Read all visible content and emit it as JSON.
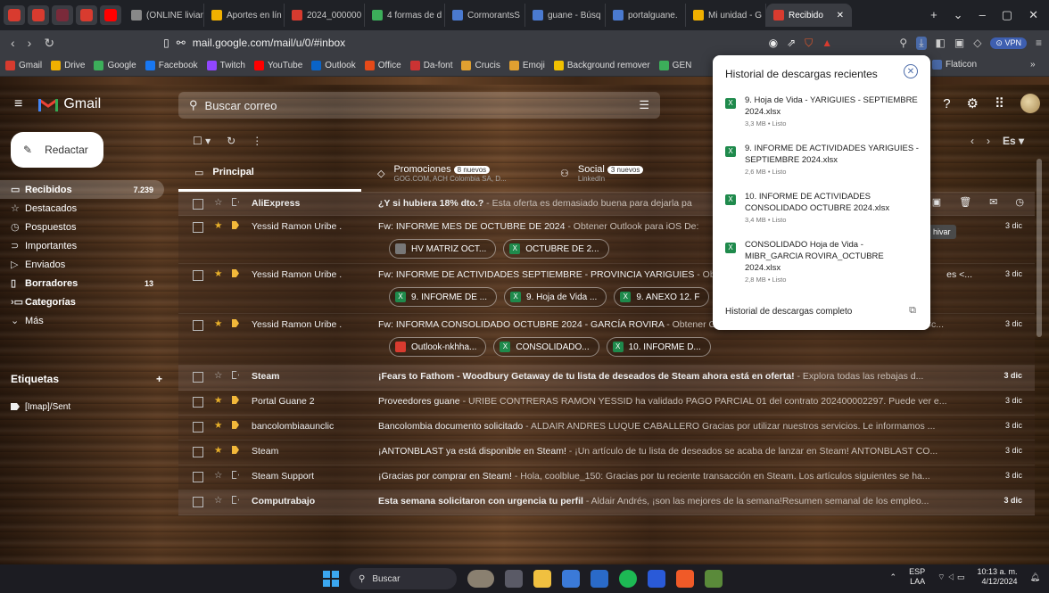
{
  "browser": {
    "tabs": [
      {
        "label": "(ONLINE livian",
        "color": "#888888"
      },
      {
        "label": "Aportes en lín",
        "color": "#f0b000"
      },
      {
        "label": "2024_000000",
        "color": "#d83b2f"
      },
      {
        "label": "4 formas de d",
        "color": "#3cae5a"
      },
      {
        "label": "CormorantsS",
        "color": "#4a7ad0"
      },
      {
        "label": "guane - Búsq",
        "color": "#4a7ad0"
      },
      {
        "label": "portalguane.",
        "color": "#4a7ad0"
      },
      {
        "label": "Mi unidad - G",
        "color": "#f0b000"
      },
      {
        "label": "Recibido",
        "color": "#d83b2f"
      }
    ],
    "url": "mail.google.com/mail/u/0/#inbox",
    "vpn_label": "VPN",
    "bookmarks": [
      {
        "label": "Gmail",
        "color": "#d83b2f"
      },
      {
        "label": "Drive",
        "color": "#f0b000"
      },
      {
        "label": "Google",
        "color": "#3cae5a"
      },
      {
        "label": "Facebook",
        "color": "#1877f2"
      },
      {
        "label": "Twitch",
        "color": "#9146ff"
      },
      {
        "label": "YouTube",
        "color": "#ff0000"
      },
      {
        "label": "Outlook",
        "color": "#0a64c8"
      },
      {
        "label": "Office",
        "color": "#e64a19"
      },
      {
        "label": "Da-font",
        "color": "#cc3333"
      },
      {
        "label": "Crucis",
        "color": "#e0a030"
      },
      {
        "label": "Emoji",
        "color": "#e0a030"
      },
      {
        "label": "Background remover",
        "color": "#f0c000"
      },
      {
        "label": "GEN",
        "color": "#3cae5a"
      }
    ],
    "bookmark_right": "Flaticon"
  },
  "gmail": {
    "app_name": "Gmail",
    "search_placeholder": "Buscar correo",
    "compose": "Redactar",
    "lang": "Es",
    "nav": [
      {
        "label": "Recibidos",
        "count": "7.239",
        "icon": "inbox-icon",
        "selected": true
      },
      {
        "label": "Destacados",
        "count": "",
        "icon": "star-icon"
      },
      {
        "label": "Pospuestos",
        "count": "",
        "icon": "clock-icon"
      },
      {
        "label": "Importantes",
        "count": "",
        "icon": "important-icon"
      },
      {
        "label": "Enviados",
        "count": "",
        "icon": "send-icon"
      },
      {
        "label": "Borradores",
        "count": "13",
        "icon": "draft-icon",
        "bold": true
      },
      {
        "label": "Categorías",
        "count": "",
        "icon": "label-icon",
        "bold": true
      },
      {
        "label": "Más",
        "count": "",
        "icon": "chevron-down-icon"
      }
    ],
    "labels_title": "Etiquetas",
    "labels_add": "+",
    "labels": [
      "[Imap]/Sent"
    ],
    "category_tabs": {
      "principal": "Principal",
      "promociones": "Promociones",
      "promociones_badge": "8 nuevos",
      "promociones_sub": "GOG.COM, ACH Colombia SA, D...",
      "social": "Social",
      "social_badge": "3 nuevos",
      "social_sub": "LinkedIn"
    },
    "archive_tooltip": "hivar",
    "emails": [
      {
        "sender": "AliExpress",
        "subject": "¿Y si hubiera 18% dto.?",
        "snippet": " - Esta oferta es demasiado buena para dejarla pa",
        "date": "",
        "bold": true,
        "starred": false,
        "chips": []
      },
      {
        "sender": "Yessid Ramon Uribe .",
        "subject": "Fw: INFORME MES DE OCTUBRE DE 2024",
        "snippet": " - Obtener Outlook para iOS De:",
        "date": "3 dic",
        "bold": false,
        "starred": true,
        "chips": [
          {
            "label": "HV MATRIZ OCT...",
            "type": "doc"
          },
          {
            "label": "OCTUBRE DE 2...",
            "type": "xl"
          }
        ]
      },
      {
        "sender": "Yessid Ramon Uribe .",
        "subject": "Fw: INFORME DE ACTIVIDADES SEPTIEMBRE - PROVINCIA YARIGUIES",
        "snippet": " - Ob",
        "date": "3 dic",
        "bold": false,
        "starred": true,
        "chips": [
          {
            "label": "9. INFORME DE ...",
            "type": "xl"
          },
          {
            "label": "9. Hoja de Vida ...",
            "type": "xl"
          },
          {
            "label": "9. ANEXO 12. F",
            "type": "xl"
          }
        ],
        "trail": "es <..."
      },
      {
        "sender": "Yessid Ramon Uribe .",
        "subject": "Fw: INFORMA CONSOLIDADO OCTUBRE 2024 - GARCÍA ROVIRA",
        "snippet": " - Obtener Outlook para iOS De: Hugo Armando Argote Acosta <c...",
        "date": "3 dic",
        "bold": false,
        "starred": true,
        "chips": [
          {
            "label": "Outlook-nkhha...",
            "type": "pdfi"
          },
          {
            "label": "CONSOLIDADO...",
            "type": "xl"
          },
          {
            "label": "10. INFORME D...",
            "type": "xl"
          }
        ]
      },
      {
        "sender": "Steam",
        "subject": "¡Fears to Fathom - Woodbury Getaway de tu lista de deseados de Steam ahora está en oferta!",
        "snippet": " - Explora todas las rebajas d...",
        "date": "3 dic",
        "bold": true,
        "starred": false,
        "chips": []
      },
      {
        "sender": "Portal Guane 2",
        "subject": "Proveedores guane",
        "snippet": " - URIBE CONTRERAS RAMON YESSID ha validado PAGO PARCIAL 01 del contrato 202400002297. Puede ver e...",
        "date": "3 dic",
        "bold": false,
        "starred": true,
        "chips": []
      },
      {
        "sender": "bancolombiaaunclic",
        "subject": "Bancolombia documento solicitado",
        "snippet": " - ALDAIR ANDRES LUQUE CABALLERO Gracias por utilizar nuestros servicios. Le informamos ...",
        "date": "3 dic",
        "bold": false,
        "starred": true,
        "chips": []
      },
      {
        "sender": "Steam",
        "subject": "¡ANTONBLAST ya está disponible en Steam!",
        "snippet": " - ¡Un artículo de tu lista de deseados se acaba de lanzar en Steam! ANTONBLAST CO...",
        "date": "3 dic",
        "bold": false,
        "starred": true,
        "chips": []
      },
      {
        "sender": "Steam Support",
        "subject": "¡Gracias por comprar en Steam!",
        "snippet": " - Hola, coolblue_150: Gracias por tu reciente transacción en Steam. Los artículos siguientes se ha...",
        "date": "3 dic",
        "bold": false,
        "starred": false,
        "chips": []
      },
      {
        "sender": "Computrabajo",
        "subject": "Esta semana solicitaron con urgencia tu perfil",
        "snippet": " - Aldair Andrés, ¡son las mejores de la semana!Resumen semanal de los empleo...",
        "date": "3 dic",
        "bold": true,
        "starred": false,
        "chips": []
      }
    ]
  },
  "downloads": {
    "title": "Historial de descargas recientes",
    "items": [
      {
        "name": "9. Hoja de Vida - YARIGUIES - SEPTIEMBRE 2024.xlsx",
        "meta": "3,3 MB • Listo"
      },
      {
        "name": "9. INFORME DE ACTIVIDADES YARIGUIES - SEPTIEMBRE 2024.xlsx",
        "meta": "2,6 MB • Listo"
      },
      {
        "name": "10. INFORME DE ACTIVIDADES CONSOLIDADO OCTUBRE 2024.xlsx",
        "meta": "3,4 MB • Listo"
      },
      {
        "name": "CONSOLIDADO Hoja de Vida - MIBR_GARCIA ROVIRA_OCTUBRE 2024.xlsx",
        "meta": "2,8 MB • Listo"
      }
    ],
    "full_history": "Historial de descargas completo"
  },
  "taskbar": {
    "search": "Buscar",
    "lang_top": "ESP",
    "lang_bottom": "LAA",
    "time": "10:13 a. m.",
    "date": "4/12/2024"
  }
}
